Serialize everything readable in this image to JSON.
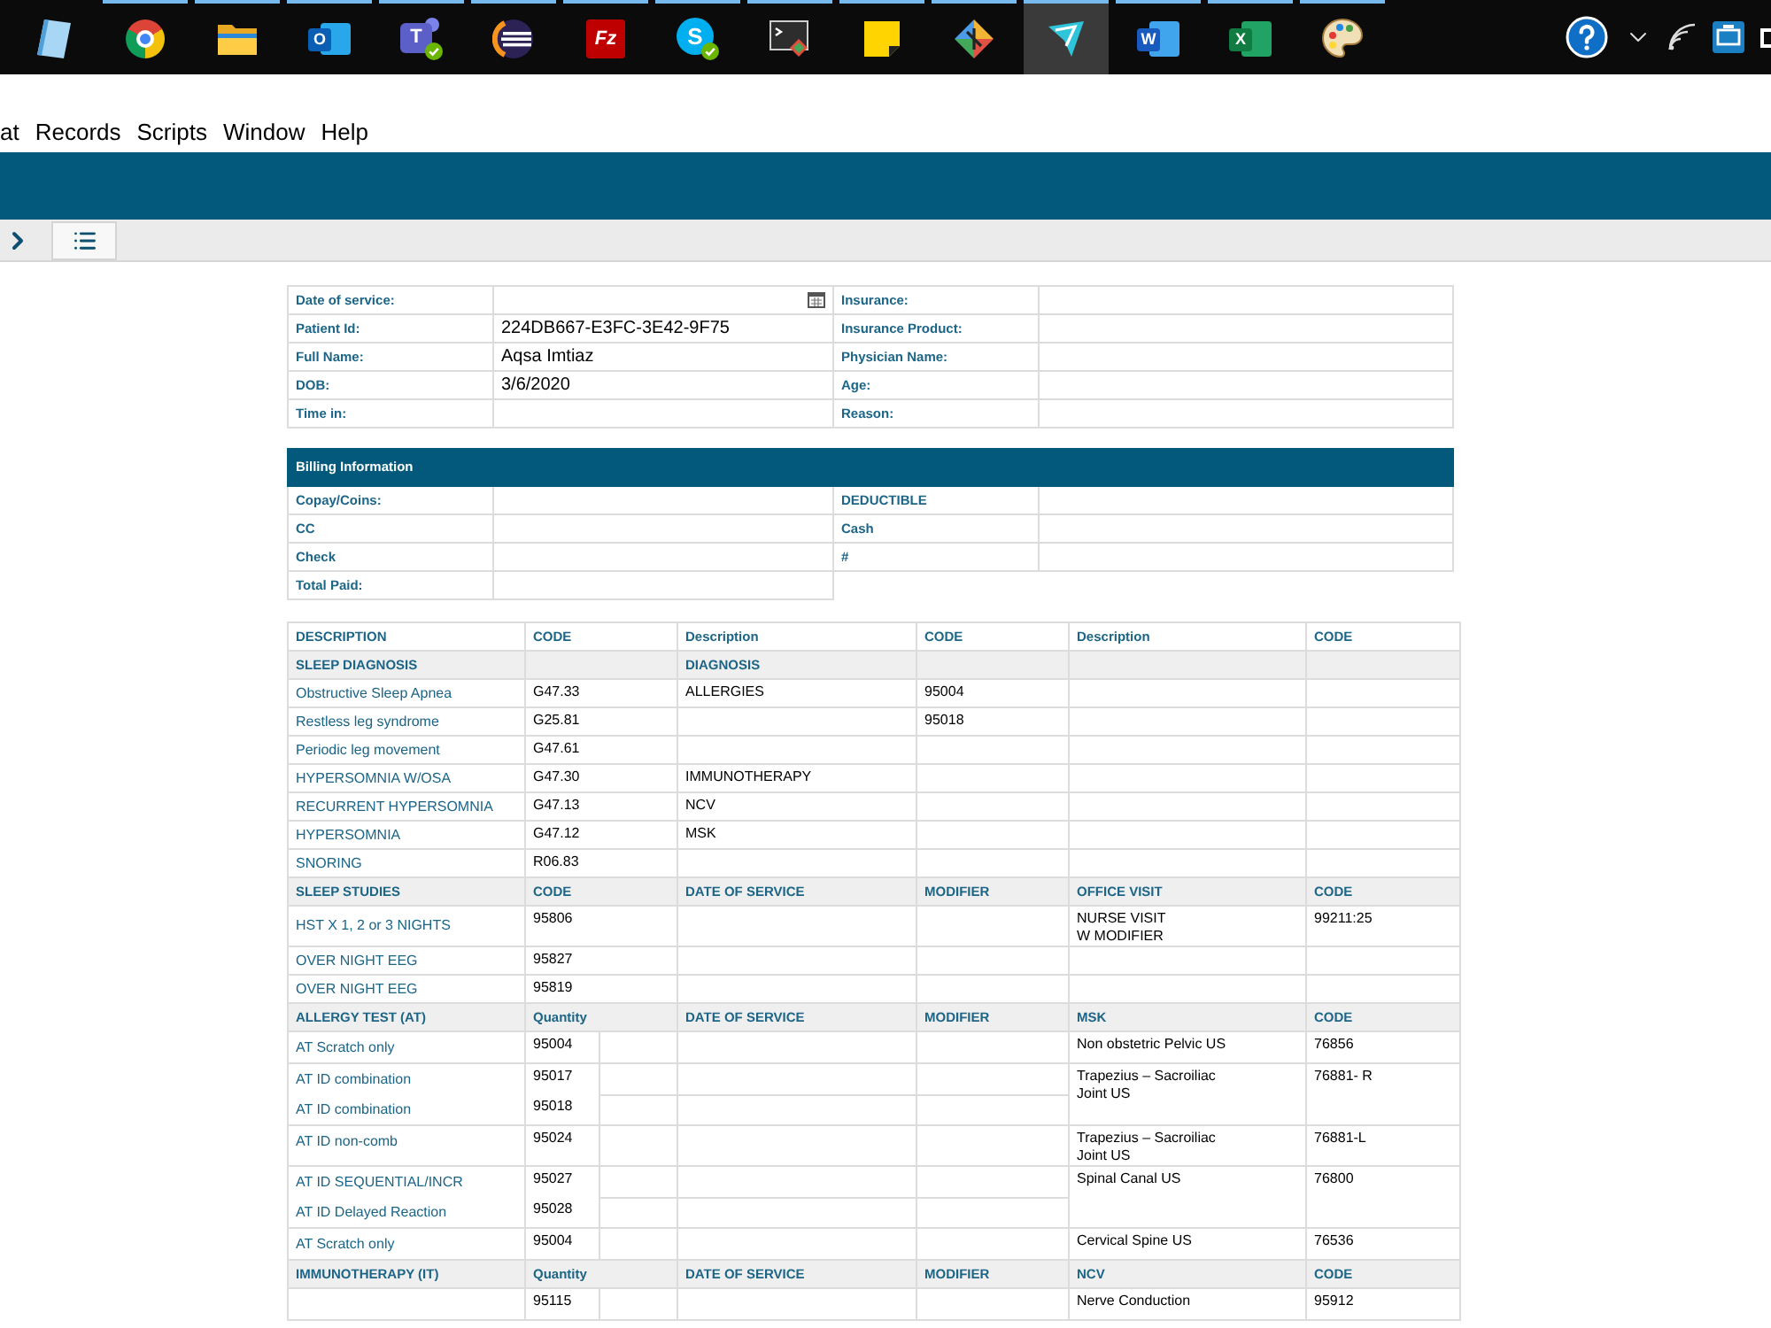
{
  "taskbar": {
    "apps": [
      {
        "kind": "book",
        "running": false,
        "selected": false,
        "badge": false
      },
      {
        "kind": "browser",
        "running": true,
        "selected": false,
        "badge": false
      },
      {
        "kind": "folder",
        "running": true,
        "selected": false,
        "badge": false
      },
      {
        "kind": "mail",
        "letter": "O",
        "running": true,
        "selected": false,
        "badge": false
      },
      {
        "kind": "people",
        "letter": "T",
        "running": true,
        "selected": false,
        "badge": true
      },
      {
        "kind": "orb",
        "running": true,
        "selected": false,
        "badge": false
      },
      {
        "kind": "tile",
        "letter": "Fz",
        "running": true,
        "selected": false,
        "badge": false
      },
      {
        "kind": "chat",
        "letter": "S",
        "running": true,
        "selected": false,
        "badge": true
      },
      {
        "kind": "terminal",
        "running": true,
        "selected": false,
        "badge": false
      },
      {
        "kind": "note",
        "running": true,
        "selected": false,
        "badge": false
      },
      {
        "kind": "diamond",
        "running": true,
        "selected": false,
        "badge": false
      },
      {
        "kind": "swoosh",
        "running": true,
        "selected": true,
        "badge": false
      },
      {
        "kind": "document",
        "letter": "W",
        "running": true,
        "selected": false,
        "badge": false
      },
      {
        "kind": "sheet",
        "letter": "X",
        "running": true,
        "selected": false,
        "badge": false
      },
      {
        "kind": "palette",
        "running": true,
        "selected": false,
        "badge": false
      }
    ],
    "tray": [
      {
        "kind": "help"
      },
      {
        "kind": "chevron"
      },
      {
        "kind": "wifi"
      },
      {
        "kind": "device"
      },
      {
        "kind": "battery"
      }
    ]
  },
  "menu": [
    "at",
    "Records",
    "Scripts",
    "Window",
    "Help"
  ],
  "toolbar": [
    {
      "kind": "forward"
    },
    {
      "kind": "list"
    }
  ],
  "patient": {
    "rows": [
      {
        "label": "Date of service:",
        "kind": "date",
        "label_2": "Insurance:"
      },
      {
        "label": "Patient Id:",
        "kind": "text",
        "value": "224DB667-E3FC-3E42-9F75",
        "label_2": "Insurance Product:"
      },
      {
        "label": "Full Name:",
        "kind": "text",
        "value": "Aqsa Imtiaz",
        "label_2": "Physician Name:"
      },
      {
        "label": "DOB:",
        "kind": "text",
        "value": "3/6/2020",
        "label_2": "Age:"
      },
      {
        "label": "Time in:",
        "kind": "text",
        "label_2": "Reason:"
      }
    ]
  },
  "billing": {
    "title": "Billing Information",
    "rows": [
      {
        "label": "Copay/Coins:",
        "label_2": "DEDUCTIBLE"
      },
      {
        "label": "CC",
        "label_2": "Cash"
      },
      {
        "label": "Check",
        "label_2": "#"
      },
      {
        "label": "Total Paid:"
      }
    ]
  },
  "codes": {
    "columns": [
      "DESCRIPTION",
      "CODE",
      "Description",
      "CODE",
      "Description",
      "CODE"
    ],
    "sections": [
      {
        "kind": "diagnosis",
        "heading": {
          "column_1": "SLEEP DIAGNOSIS",
          "column_3": "DIAGNOSIS"
        },
        "rows": [
          {
            "column_1": "Obstructive Sleep Apnea",
            "column_2": "G47.33",
            "column_3": "ALLERGIES",
            "column_4": "95004"
          },
          {
            "column_1": "Restless leg syndrome",
            "column_2": "G25.81",
            "column_4": "95018"
          },
          {
            "column_1": "Periodic leg movement",
            "column_2": "G47.61"
          },
          {
            "column_1": "HYPERSOMNIA W/OSA",
            "column_2": "G47.30",
            "column_3": "IMMUNOTHERAPY"
          },
          {
            "column_1": "RECURRENT HYPERSOMNIA",
            "column_2": "G47.13",
            "column_3": "NCV"
          },
          {
            "column_1": "HYPERSOMNIA",
            "column_2": "G47.12",
            "column_3": "MSK"
          },
          {
            "column_1": "SNORING",
            "column_2": "R06.83"
          }
        ]
      },
      {
        "kind": "studies",
        "heading": {
          "column_1": "SLEEP STUDIES",
          "column_2": "CODE",
          "column_3": "DATE OF SERVICE",
          "column_4": "MODIFIER",
          "column_5": "OFFICE VISIT",
          "column_6": "CODE"
        },
        "rows": [
          {
            "column_1": "HST X 1, 2 or 3 NIGHTS",
            "column_2": "95806",
            "column_5": "NURSE VISIT\nW MODIFIER",
            "column_6": "99211:25"
          },
          {
            "column_1": "OVER NIGHT EEG",
            "column_2": "95827"
          },
          {
            "column_1": "OVER NIGHT EEG",
            "column_2": "95819"
          }
        ]
      },
      {
        "kind": "tests",
        "heading": {
          "column_1": "ALLERGY TEST (AT)",
          "column_2": "Quantity",
          "column_3": "DATE OF SERVICE",
          "column_4": "MODIFIER",
          "column_5": "MSK",
          "column_6": "CODE"
        },
        "groups": [
          {
            "items": [
              {
                "column_1": "AT Scratch only",
                "column_2": "95004"
              }
            ],
            "column_5": "Non obstetric Pelvic US",
            "column_6": "76856"
          },
          {
            "items": [
              {
                "column_1": "AT ID combination",
                "column_2": "95017"
              },
              {
                "column_1": "AT ID combination",
                "column_2": "95018"
              }
            ],
            "column_5": "Trapezius – Sacroiliac\nJoint US",
            "column_6": "76881- R"
          },
          {
            "items": [
              {
                "column_1": "AT ID non-comb",
                "column_2": "95024"
              }
            ],
            "column_5": "Trapezius – Sacroiliac\nJoint US",
            "column_6": "76881-L"
          },
          {
            "items": [
              {
                "column_1": "AT ID SEQUENTIAL/INCR",
                "column_2": "95027"
              },
              {
                "column_1": "AT ID Delayed Reaction",
                "column_2": "95028"
              }
            ],
            "column_5": "Spinal Canal US",
            "column_6": "76800"
          },
          {
            "items": [
              {
                "column_1": "AT Scratch only",
                "column_2": "95004"
              }
            ],
            "column_5": "Cervical Spine US",
            "column_6": "76536"
          }
        ]
      },
      {
        "kind": "tests",
        "heading": {
          "column_1": "IMMUNOTHERAPY (IT)",
          "column_2": "Quantity",
          "column_3": "DATE OF SERVICE",
          "column_4": "MODIFIER",
          "column_5": "NCV",
          "column_6": "CODE"
        },
        "groups": [
          {
            "items": [
              {
                "column_2": "95115"
              }
            ],
            "column_5": "Nerve Conduction",
            "column_6": "95912"
          }
        ]
      }
    ]
  }
}
